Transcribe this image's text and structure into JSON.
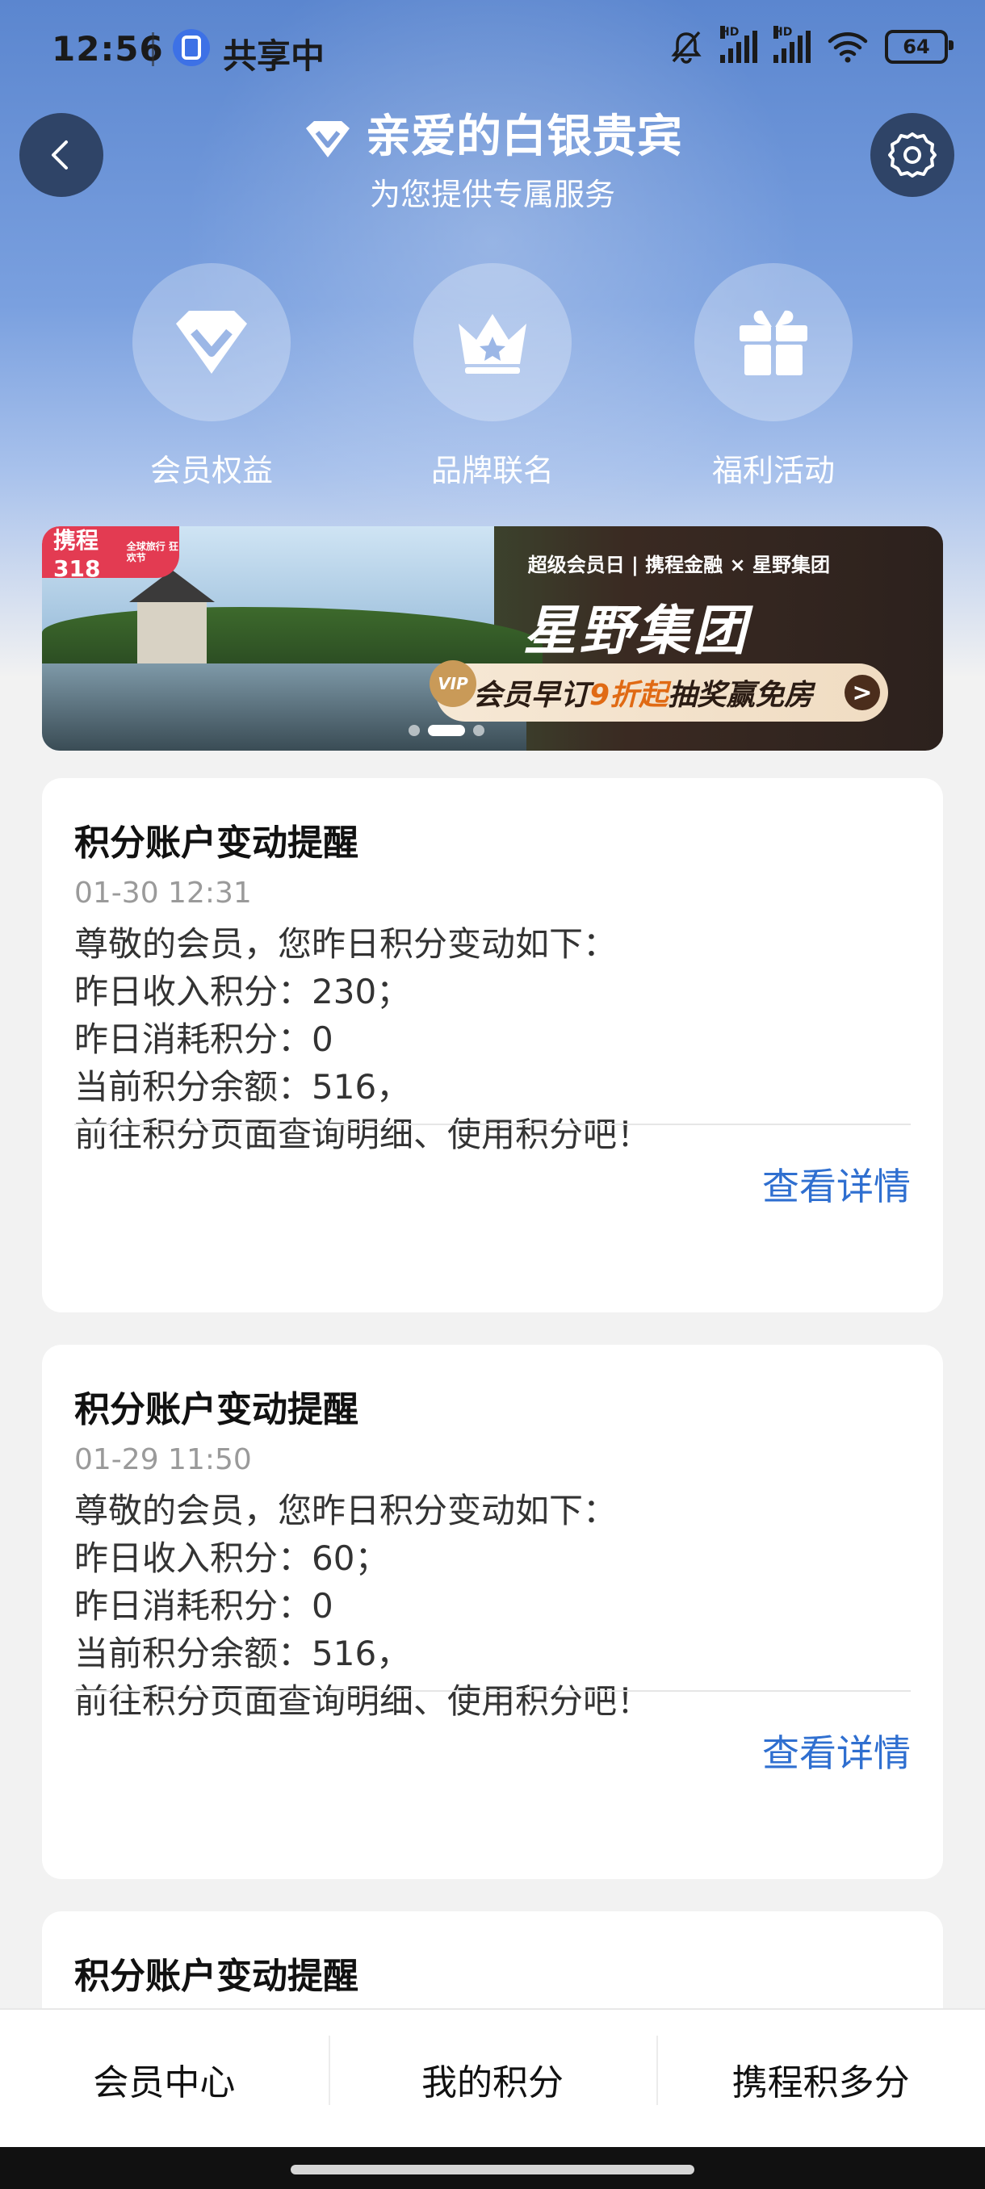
{
  "status_bar": {
    "time": "12:56",
    "share_text": "共享中",
    "battery": "64",
    "hd_label": "HD"
  },
  "header": {
    "title": "亲爱的白银贵宾",
    "subtitle": "为您提供专属服务"
  },
  "features": [
    {
      "label": "会员权益",
      "icon": "diamond-icon"
    },
    {
      "label": "品牌联名",
      "icon": "crown-icon"
    },
    {
      "label": "福利活动",
      "icon": "gift-icon"
    }
  ],
  "banner": {
    "tag": "携程318",
    "tag_sub": "全球旅行 狂欢节",
    "top_line": "超级会员日 | 携程金融 × 星野集团",
    "brand": "星野集团",
    "promo_prefix": "会员早订",
    "promo_highlight": "9折起",
    "promo_suffix": " 抽奖赢免房",
    "vip": "VIP",
    "go": ">"
  },
  "cards": [
    {
      "title": "积分账户变动提醒",
      "time": "01-30 12:31",
      "lines": [
        "尊敬的会员，您昨日积分变动如下：",
        "昨日收入积分：230；",
        "昨日消耗积分：0",
        "当前积分余额：516，",
        "前往积分页面查询明细、使用积分吧！"
      ],
      "more": "查看详情"
    },
    {
      "title": "积分账户变动提醒",
      "time": "01-29 11:50",
      "lines": [
        "尊敬的会员，您昨日积分变动如下：",
        "昨日收入积分：60；",
        "昨日消耗积分：0",
        "当前积分余额：516，",
        "前往积分页面查询明细、使用积分吧！"
      ],
      "more": "查看详情"
    },
    {
      "title": "积分账户变动提醒"
    }
  ],
  "bottom_tabs": [
    "会员中心",
    "我的积分",
    "携程积多分"
  ],
  "colors": {
    "link": "#2f6fd0",
    "hero": "#5b86cf"
  }
}
